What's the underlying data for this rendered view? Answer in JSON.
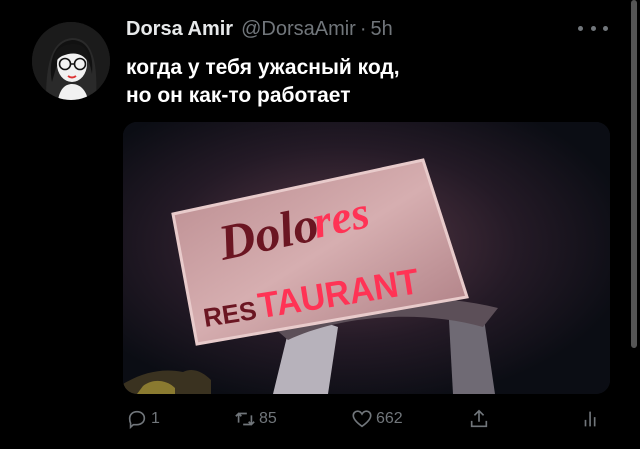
{
  "author": {
    "name": "Dorsa Amir",
    "handle": "@DorsaAmir",
    "separator": "·",
    "time": "5h"
  },
  "tweet": {
    "lines": [
      "когда у тебя ужасный код,",
      "но он как-то работает"
    ]
  },
  "media": {
    "sign": {
      "top_dark": "Dolo",
      "top_lit": "res",
      "bottom_dark": "RES",
      "bottom_lit": "TAURANT"
    }
  },
  "actions": {
    "reply_count": "1",
    "retweet_count": "85",
    "like_count": "662"
  },
  "icons": {
    "more": "more-dots-icon",
    "reply": "reply-icon",
    "retweet": "retweet-icon",
    "like": "heart-icon",
    "share": "share-icon",
    "analytics": "analytics-icon"
  },
  "colors": {
    "background": "#000000",
    "text": "#ffffff",
    "muted": "#71767b",
    "neon_red": "#ff3355"
  }
}
